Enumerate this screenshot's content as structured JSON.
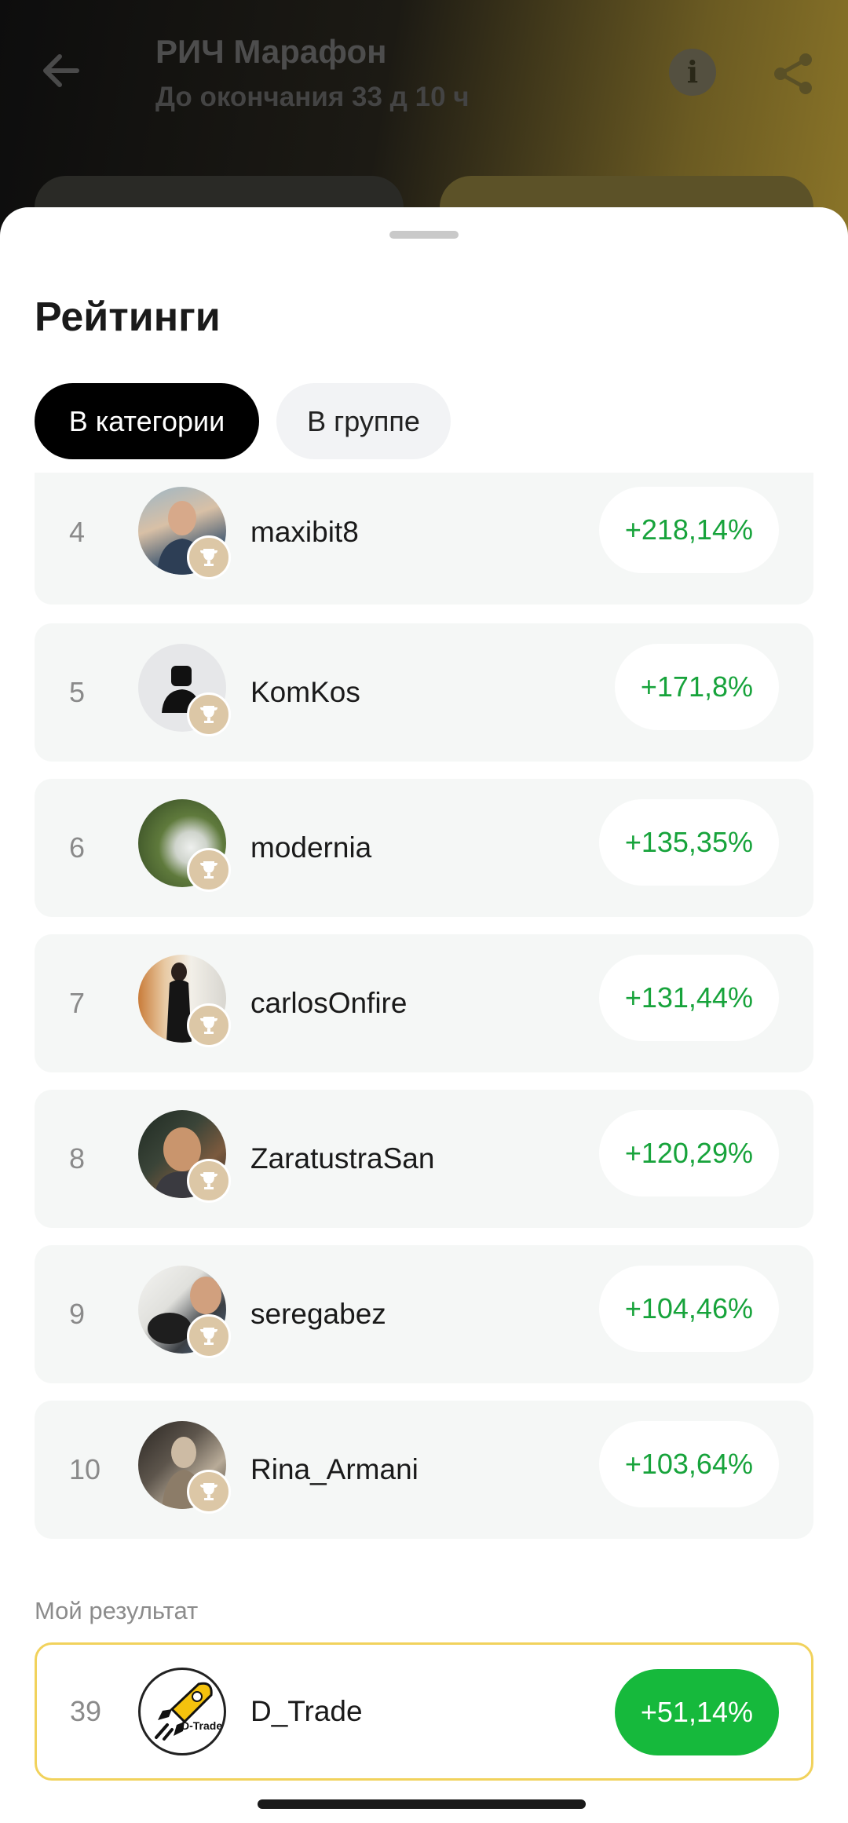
{
  "header": {
    "title": "РИЧ Марафон",
    "subtitle": "До окончания 33 д 10 ч"
  },
  "sheet": {
    "title": "Рейтинги",
    "tabs": [
      {
        "label": "В категории",
        "active": true
      },
      {
        "label": "В группе",
        "active": false
      }
    ]
  },
  "rows": [
    {
      "rank": "4",
      "name": "maxibit8",
      "result": "+218,14%"
    },
    {
      "rank": "5",
      "name": "KomKos",
      "result": "+171,8%"
    },
    {
      "rank": "6",
      "name": "modernia",
      "result": "+135,35%"
    },
    {
      "rank": "7",
      "name": "carlosOnfire",
      "result": "+131,44%"
    },
    {
      "rank": "8",
      "name": "ZaratustraSan",
      "result": "+120,29%"
    },
    {
      "rank": "9",
      "name": "seregabez",
      "result": "+104,46%"
    },
    {
      "rank": "10",
      "name": "Rina_Armani",
      "result": "+103,64%"
    }
  ],
  "my_result": {
    "label": "Мой результат",
    "rank": "39",
    "name": "D_Trade",
    "result": "+51,14%",
    "avatar_text": "D-Trade"
  },
  "colors": {
    "positive": "#17a33b",
    "my_result_bg": "#16b93c",
    "my_result_border": "#f1d25c",
    "trophy_badge": "#dcc7a6"
  }
}
